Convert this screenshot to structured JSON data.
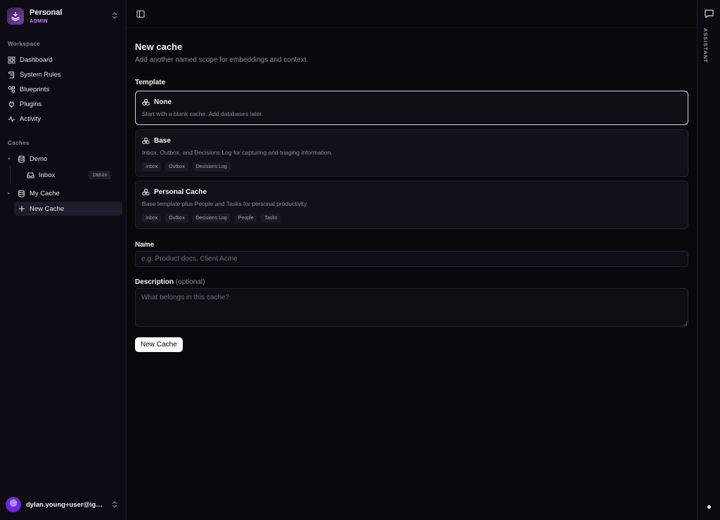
{
  "workspace": {
    "name": "Personal",
    "role": "ADMIN"
  },
  "sidebar": {
    "workspace_label": "Workspace",
    "nav": [
      {
        "label": "Dashboard",
        "icon": "grid-icon"
      },
      {
        "label": "System Rules",
        "icon": "scroll-icon"
      },
      {
        "label": "Blueprints",
        "icon": "nodes-icon"
      },
      {
        "label": "Plugins",
        "icon": "plug-icon"
      },
      {
        "label": "Activity",
        "icon": "pulse-icon"
      }
    ],
    "caches_label": "Caches",
    "caches": [
      {
        "label": "Demo",
        "icon": "database-icon",
        "expanded": true,
        "children": [
          {
            "label": "Inbox",
            "badge": "INBOX",
            "icon": "inbox-icon"
          }
        ]
      },
      {
        "label": "My Cache",
        "icon": "database-icon",
        "expanded": false
      },
      {
        "label": "New Cache",
        "icon": "plus-icon",
        "active": true
      }
    ]
  },
  "user": {
    "email": "dylan.young+user@ign..."
  },
  "main": {
    "title": "New cache",
    "subtitle": "Add another named scope for embeddings and context.",
    "template_label": "Template",
    "templates": [
      {
        "name": "None",
        "description": "Start with a blank cache. Add databases later.",
        "chips": [],
        "selected": true
      },
      {
        "name": "Base",
        "description": "Inbox, Outbox, and Decisions Log for capturing and triaging information.",
        "chips": [
          "Inbox",
          "Outbox",
          "Decisions Log"
        ],
        "selected": false
      },
      {
        "name": "Personal Cache",
        "description": "Base template plus People and Tasks for personal productivity.",
        "chips": [
          "Inbox",
          "Outbox",
          "Decisions Log",
          "People",
          "Tasks"
        ],
        "selected": false
      }
    ],
    "name_label": "Name",
    "name_placeholder": "e.g. Product docs, Client Acme",
    "name_value": "",
    "description_label": "Description",
    "description_optional": "(optional)",
    "description_placeholder": "What belongs in this cache?",
    "description_value": "",
    "submit_label": "New Cache"
  },
  "rail": {
    "label": "ASSISTANT"
  },
  "colors": {
    "accent": "#c084fc",
    "background": "#09090b",
    "primary_button": "#fafafa"
  }
}
